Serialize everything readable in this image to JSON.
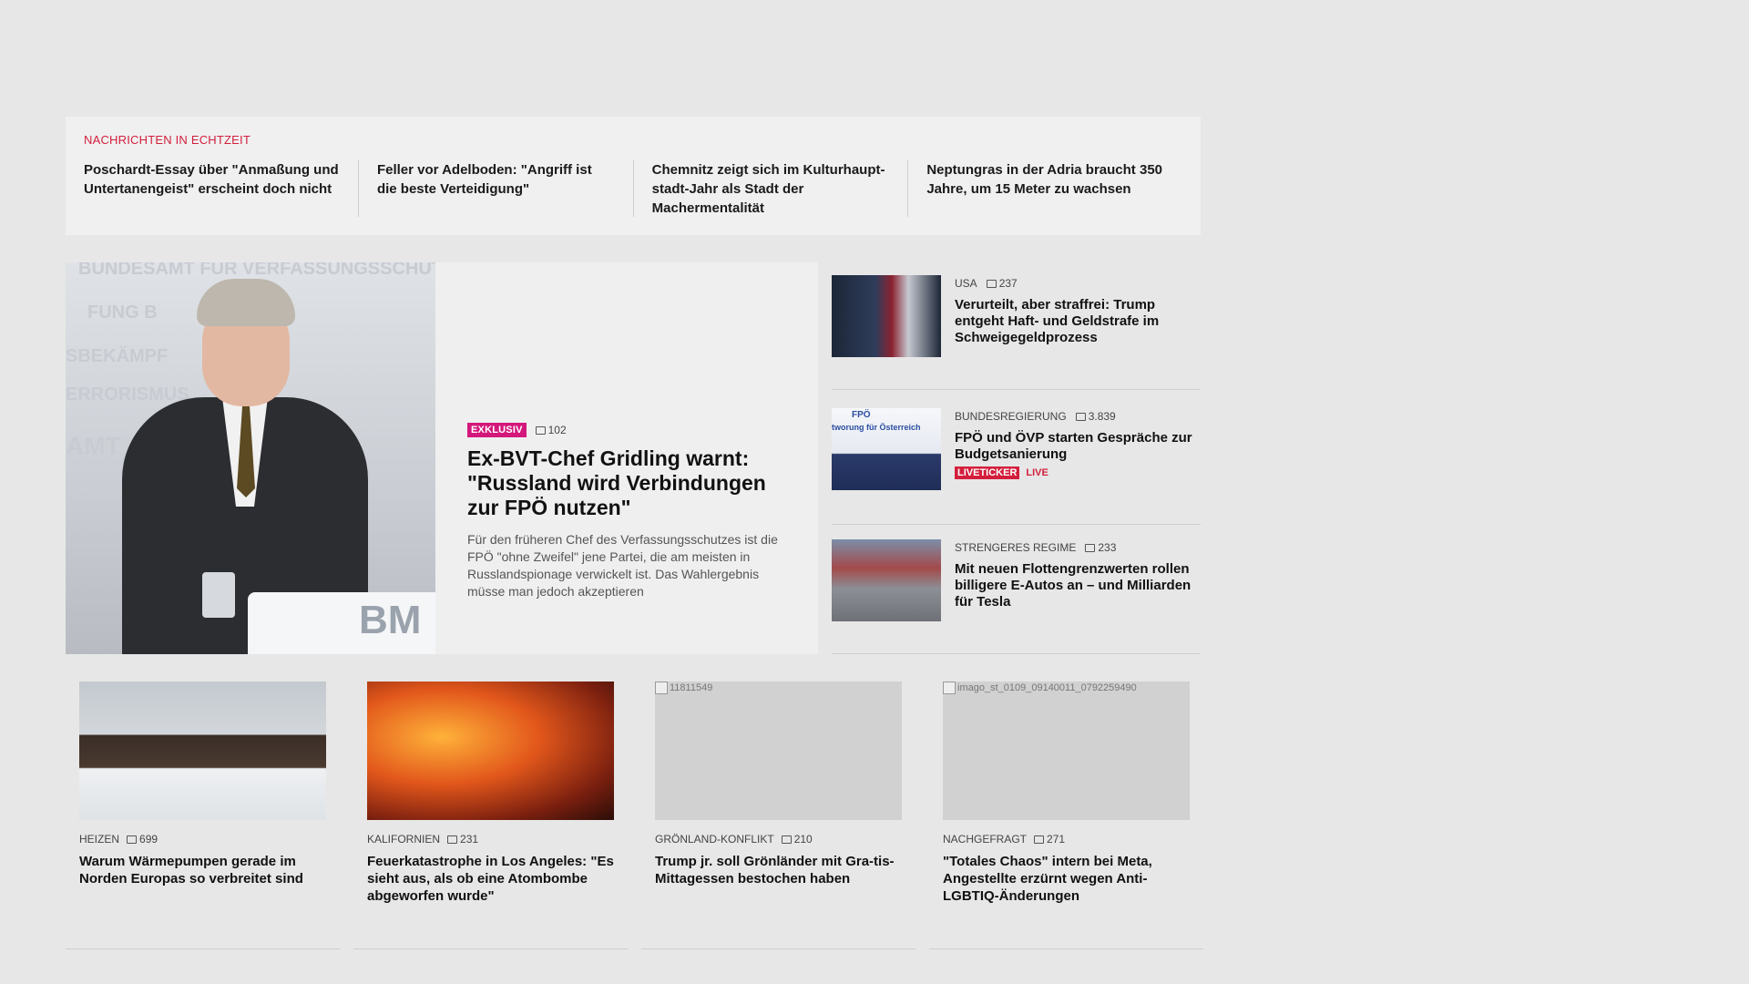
{
  "ticker": {
    "heading": "NACHRICHTEN IN ECHTZEIT",
    "items": [
      "Poschardt-Essay über \"Anmaßung und Untertanengeist\" erscheint doch nicht",
      "Feller vor Adelboden: \"Angriff ist die beste Verteidigung\"",
      "Chemnitz zeigt sich im Kulturhaupt-stadt-Jahr als Stadt der Machermentalität",
      "Neptungras in der Adria braucht 350 Jahre, um 15 Meter zu wachsen"
    ]
  },
  "hero": {
    "badge": "EXKLUSIV",
    "comments": "102",
    "title": "Ex-BVT-Chef Gridling warnt: \"Russland wird Verbindungen zur FPÖ nutzen\"",
    "teaser": "Für den früheren Chef des Verfassungsschutzes ist die FPÖ \"ohne Zweifel\" jene Partei, die am meisten in Russlandspionage verwickelt ist. Das Wahlergebnis müsse man jedoch akzeptieren",
    "image_text": {
      "line1": "BUNDESAMT FÜR VERFASSUNGSSCHUTZ UND",
      "line2": "FUNG B",
      "line3": "SBEKÄMPF",
      "line4": "ERRORISMUS",
      "line5": "AMT",
      "lectern": "BM"
    }
  },
  "side": [
    {
      "category": "USA",
      "comments": "237",
      "title": "Verurteilt, aber straffrei: Trump entgeht Haft- und Geldstrafe im Schweigegeldprozess"
    },
    {
      "category": "BUNDESREGIERUNG",
      "comments": "3.839",
      "title": "FPÖ und ÖVP starten Gespräche zur Budgetsanierung",
      "liveticker": "LIVETICKER",
      "live": "LIVE",
      "thumb_text": "FPÖ",
      "thumb_text2": "tworung für Österreich"
    },
    {
      "category": "STRENGERES REGIME",
      "comments": "233",
      "title": "Mit neuen Flottengrenzwerten rollen billigere E-Autos an – und Milliarden für Tesla"
    }
  ],
  "cards": [
    {
      "category": "HEIZEN",
      "comments": "699",
      "title": "Warum Wärmepumpen gerade im Norden Europas so verbreitet sind"
    },
    {
      "category": "KALIFORNIEN",
      "comments": "231",
      "title": "Feuerkatastrophe in Los Angeles: \"Es sieht aus, als ob eine Atombombe abgeworfen wurde\""
    },
    {
      "category": "GRÖNLAND-KONFLIKT",
      "comments": "210",
      "title": "Trump jr. soll Grönländer mit Gra-tis-Mittagessen bestochen haben",
      "alt": "11811549"
    },
    {
      "category": "NACHGEFRAGT",
      "comments": "271",
      "title": "\"Totales Chaos\" intern bei Meta, Angestellte erzürnt wegen Anti-LGBTIQ-Änderungen",
      "alt": "imago_st_0109_09140011_0792259490"
    }
  ],
  "colors": {
    "accent_red": "#d31f3c",
    "exklusiv_magenta": "#d4177b",
    "background": "#e7e7e7"
  }
}
